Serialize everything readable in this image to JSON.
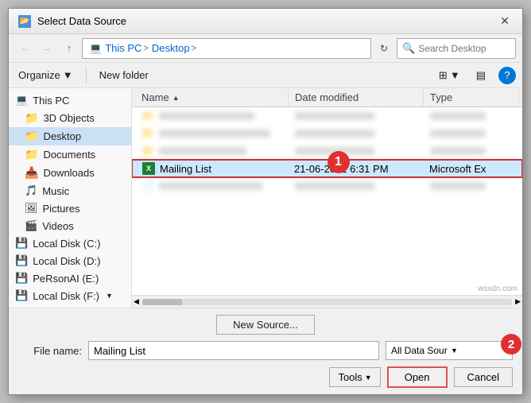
{
  "dialog": {
    "title": "Select Data Source",
    "close_label": "✕"
  },
  "nav": {
    "back_title": "Back",
    "forward_title": "Forward",
    "up_title": "Up",
    "breadcrumbs": [
      "This PC",
      "Desktop"
    ],
    "refresh_title": "Refresh",
    "search_placeholder": "Search Desktop"
  },
  "toolbar": {
    "organize_label": "Organize",
    "new_folder_label": "New folder",
    "view_icon": "⊞",
    "pane_icon": "▤",
    "help_icon": "?"
  },
  "sidebar": {
    "items": [
      {
        "id": "this-pc",
        "label": "This PC",
        "icon": "💻",
        "indent": 0
      },
      {
        "id": "3d-objects",
        "label": "3D Objects",
        "icon": "📁",
        "indent": 1
      },
      {
        "id": "desktop",
        "label": "Desktop",
        "icon": "📁",
        "indent": 1,
        "selected": true
      },
      {
        "id": "documents",
        "label": "Documents",
        "icon": "📁",
        "indent": 1
      },
      {
        "id": "downloads",
        "label": "Downloads",
        "icon": "📥",
        "indent": 1
      },
      {
        "id": "music",
        "label": "Music",
        "icon": "🎵",
        "indent": 1
      },
      {
        "id": "pictures",
        "label": "Pictures",
        "icon": "🖼",
        "indent": 1
      },
      {
        "id": "videos",
        "label": "Videos",
        "icon": "🎬",
        "indent": 1
      },
      {
        "id": "local-c",
        "label": "Local Disk (C:)",
        "icon": "💾",
        "indent": 0
      },
      {
        "id": "local-d",
        "label": "Local Disk (D:)",
        "icon": "💾",
        "indent": 0
      },
      {
        "id": "personai-e",
        "label": "PeRsonAI (E:)",
        "icon": "💾",
        "indent": 0
      },
      {
        "id": "local-f",
        "label": "Local Disk (F:)",
        "icon": "💾",
        "indent": 0
      }
    ]
  },
  "file_list": {
    "columns": [
      {
        "id": "name",
        "label": "Name",
        "sort": "▲"
      },
      {
        "id": "date",
        "label": "Date modified"
      },
      {
        "id": "type",
        "label": "Type"
      }
    ],
    "rows": [
      {
        "id": "blurred-1",
        "blurred": true,
        "name": "",
        "date": "",
        "type": ""
      },
      {
        "id": "blurred-2",
        "blurred": true,
        "name": "",
        "date": "",
        "type": ""
      },
      {
        "id": "blurred-3",
        "blurred": true,
        "name": "",
        "date": "",
        "type": ""
      },
      {
        "id": "mailing-list",
        "blurred": false,
        "selected": true,
        "name": "Mailing List",
        "date": "21-06-2022 6:31 PM",
        "type": "Microsoft Ex"
      },
      {
        "id": "blurred-5",
        "blurred": true,
        "name": "",
        "date": "",
        "type": ""
      }
    ]
  },
  "bottom": {
    "new_source_label": "New Source...",
    "file_name_label": "File name:",
    "file_name_value": "Mailing List",
    "file_type_value": "All Data Sour",
    "tools_label": "Tools",
    "open_label": "Open",
    "cancel_label": "Cancel"
  },
  "badges": {
    "badge1": "1",
    "badge2": "2"
  },
  "watermark": "wsxdn.com"
}
